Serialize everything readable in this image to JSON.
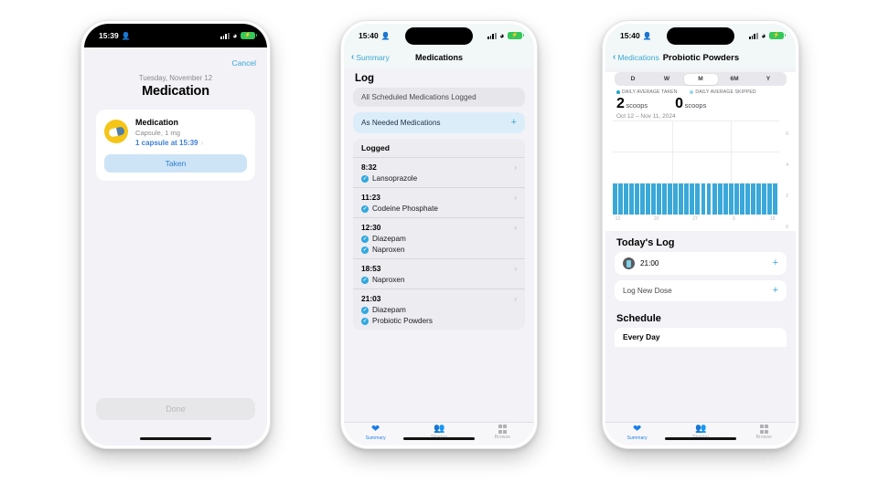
{
  "phone1": {
    "statusbar": {
      "time": "15:39",
      "person_icon": "person-icon",
      "signal_icon": "cellular-bars-icon",
      "wifi_icon": "wifi-icon",
      "battery_icon": "battery-charging-icon"
    },
    "cancel_label": "Cancel",
    "date": "Tuesday, November 12",
    "heading": "Medication",
    "card": {
      "icon": "capsule-icon",
      "name": "Medication",
      "subtitle": "Capsule, 1 mg",
      "dose_link": "1 capsule at 15:39",
      "chevron": "›",
      "action_label": "Taken"
    },
    "done_label": "Done"
  },
  "phone2": {
    "statusbar": {
      "time": "15:40",
      "person_icon": "person-icon"
    },
    "nav": {
      "back_label": "Summary",
      "title": "Medications"
    },
    "log_title": "Log",
    "all_logged_label": "All Scheduled Medications Logged",
    "as_needed_label": "As Needed Medications",
    "as_needed_plus": "+",
    "logged_header": "Logged",
    "entries": [
      {
        "time": "8:32",
        "meds": [
          "Lansoprazole"
        ]
      },
      {
        "time": "11:23",
        "meds": [
          "Codeine Phosphate"
        ]
      },
      {
        "time": "12:30",
        "meds": [
          "Diazepam",
          "Naproxen"
        ]
      },
      {
        "time": "18:53",
        "meds": [
          "Naproxen"
        ]
      },
      {
        "time": "21:03",
        "meds": [
          "Diazepam",
          "Probiotic Powders"
        ]
      }
    ],
    "tabs": [
      {
        "label": "Summary",
        "icon": "heart-icon",
        "active": true
      },
      {
        "label": "Sharing",
        "icon": "people-icon",
        "active": false
      },
      {
        "label": "Browse",
        "icon": "grid-icon",
        "active": false
      }
    ]
  },
  "phone3": {
    "statusbar": {
      "time": "15:40",
      "person_icon": "person-icon"
    },
    "nav": {
      "back_label": "Medications",
      "title": "Probiotic Powders"
    },
    "segments": [
      "D",
      "W",
      "M",
      "6M",
      "Y"
    ],
    "segment_selected": "M",
    "legend": [
      {
        "label": "DAILY AVERAGE TAKEN",
        "color": "#2aa8c4"
      },
      {
        "label": "DAILY AVERAGE SKIPPED",
        "color": "#9fd9e8"
      }
    ],
    "stats": [
      {
        "value": "2",
        "unit": "scoops"
      },
      {
        "value": "0",
        "unit": "scoops"
      }
    ],
    "date_range": "Oct 12 – Nov 11, 2024",
    "todays_log_title": "Today's Log",
    "todays_log_entry": {
      "icon": "scoop-icon",
      "time": "21:00",
      "plus": "+"
    },
    "log_new_dose_label": "Log New Dose",
    "log_new_dose_plus": "+",
    "schedule_title": "Schedule",
    "schedule_value": "Every Day",
    "tabs": [
      {
        "label": "Summary",
        "icon": "heart-icon",
        "active": true
      },
      {
        "label": "Sharing",
        "icon": "people-icon",
        "active": false
      },
      {
        "label": "Browse",
        "icon": "grid-icon",
        "active": false
      }
    ],
    "chart_data": {
      "type": "bar",
      "title": "Daily Average Taken",
      "xlabel": "",
      "ylabel": "scoops",
      "ylim": [
        0,
        6
      ],
      "yticks": [
        0,
        2,
        4,
        6
      ],
      "grid": true,
      "legend_position": "top",
      "categories": [
        "13",
        "14",
        "15",
        "16",
        "17",
        "18",
        "19",
        "20",
        "21",
        "22",
        "23",
        "24",
        "25",
        "26",
        "27",
        "28",
        "29",
        "30",
        "31",
        "1",
        "2",
        "3",
        "4",
        "5",
        "6",
        "7",
        "8",
        "9",
        "10",
        "11"
      ],
      "tick_labels": [
        "13",
        "20",
        "27",
        "3",
        "10"
      ],
      "series": [
        {
          "name": "Daily Average Taken",
          "color": "#3aa8d8",
          "values": [
            2,
            2,
            2,
            2,
            2,
            2,
            2,
            2,
            2,
            2,
            2,
            2,
            2,
            2,
            2,
            2,
            2,
            2,
            2,
            2,
            2,
            2,
            2,
            2,
            2,
            2,
            2,
            2,
            2,
            2
          ]
        },
        {
          "name": "Daily Average Skipped",
          "color": "#9fd9e8",
          "values": [
            0,
            0,
            0,
            0,
            0,
            0,
            0,
            0,
            0,
            0,
            0,
            0,
            0,
            0,
            0,
            0,
            0,
            0,
            0,
            0,
            0,
            0,
            0,
            0,
            0,
            0,
            0,
            0,
            0,
            0
          ]
        }
      ]
    }
  }
}
